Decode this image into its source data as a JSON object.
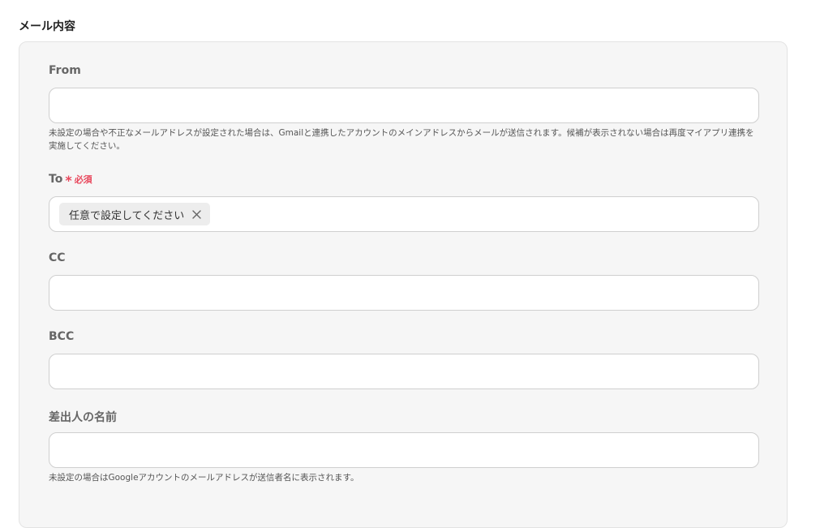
{
  "section": {
    "title": "メール内容"
  },
  "fields": {
    "from": {
      "label": "From",
      "value": "",
      "help": "未設定の場合や不正なメールアドレスが設定された場合は、Gmailと連携したアカウントのメインアドレスからメールが送信されます。候補が表示されない場合は再度マイアプリ連携を実施してください。"
    },
    "to": {
      "label": "To",
      "required_mark": "*",
      "required_label": "必須",
      "chips": [
        {
          "label": "任意で設定してください",
          "remove_icon": "close-icon"
        }
      ]
    },
    "cc": {
      "label": "CC",
      "value": ""
    },
    "bcc": {
      "label": "BCC",
      "value": ""
    },
    "sender_name": {
      "label": "差出人の名前",
      "value": "",
      "help": "未設定の場合はGoogleアカウントのメールアドレスが送信者名に表示されます。"
    }
  },
  "colors": {
    "required": "#e8465b",
    "panel_bg": "#f6f6f6",
    "input_border": "#cfcfcf",
    "chip_bg": "#ededed"
  }
}
